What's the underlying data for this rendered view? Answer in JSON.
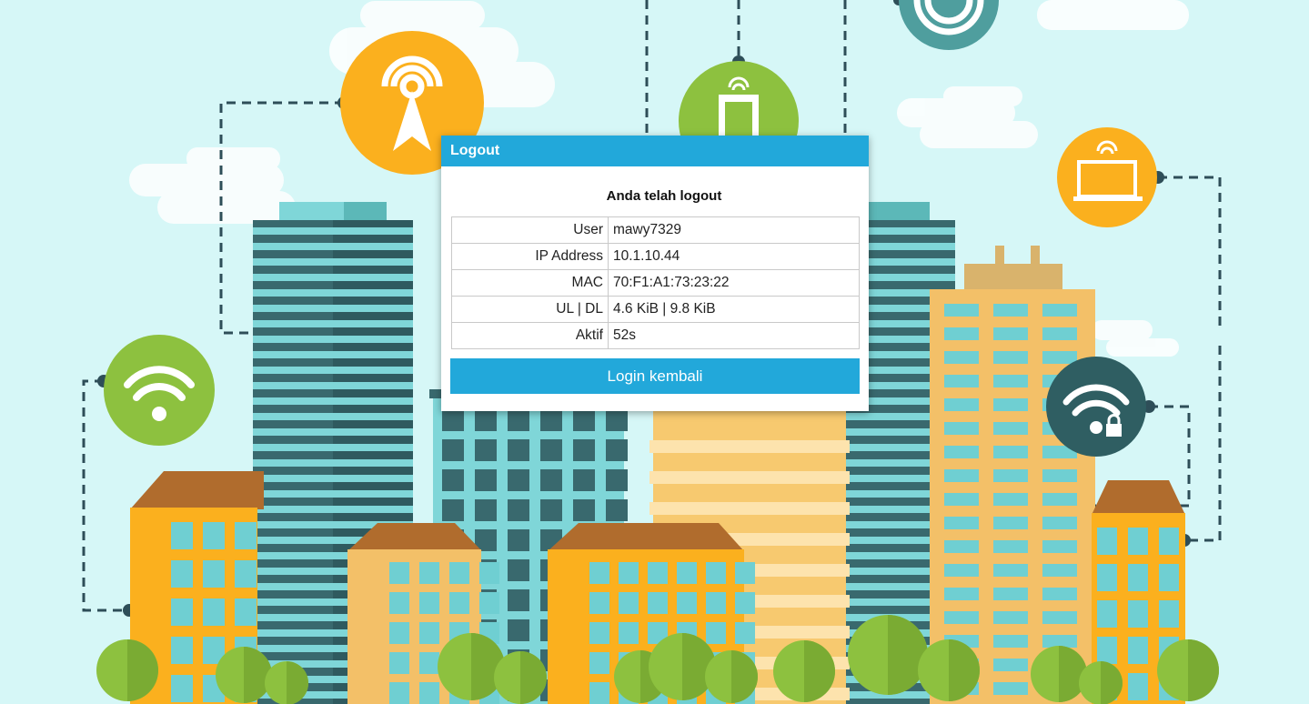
{
  "dialog": {
    "title": "Logout",
    "message": "Anda telah logout",
    "rows": [
      {
        "label": "User",
        "value": "mawy7329"
      },
      {
        "label": "IP Address",
        "value": "10.1.10.44"
      },
      {
        "label": "MAC",
        "value": "70:F1:A1:73:23:22"
      },
      {
        "label": "UL | DL",
        "value": "4.6 KiB | 9.8 KiB"
      },
      {
        "label": "Aktif",
        "value": "52s"
      }
    ],
    "button_label": "Login kembali"
  },
  "colors": {
    "accent": "#22a8da",
    "sky": "#d6f7f7",
    "orange": "#fbb01e",
    "green": "#8dc13f",
    "teal": "#2f7a7a"
  },
  "background_icons": [
    "antenna-icon",
    "phone-icon",
    "wifi-icon",
    "laptop-icon",
    "wifi-lock-icon"
  ]
}
